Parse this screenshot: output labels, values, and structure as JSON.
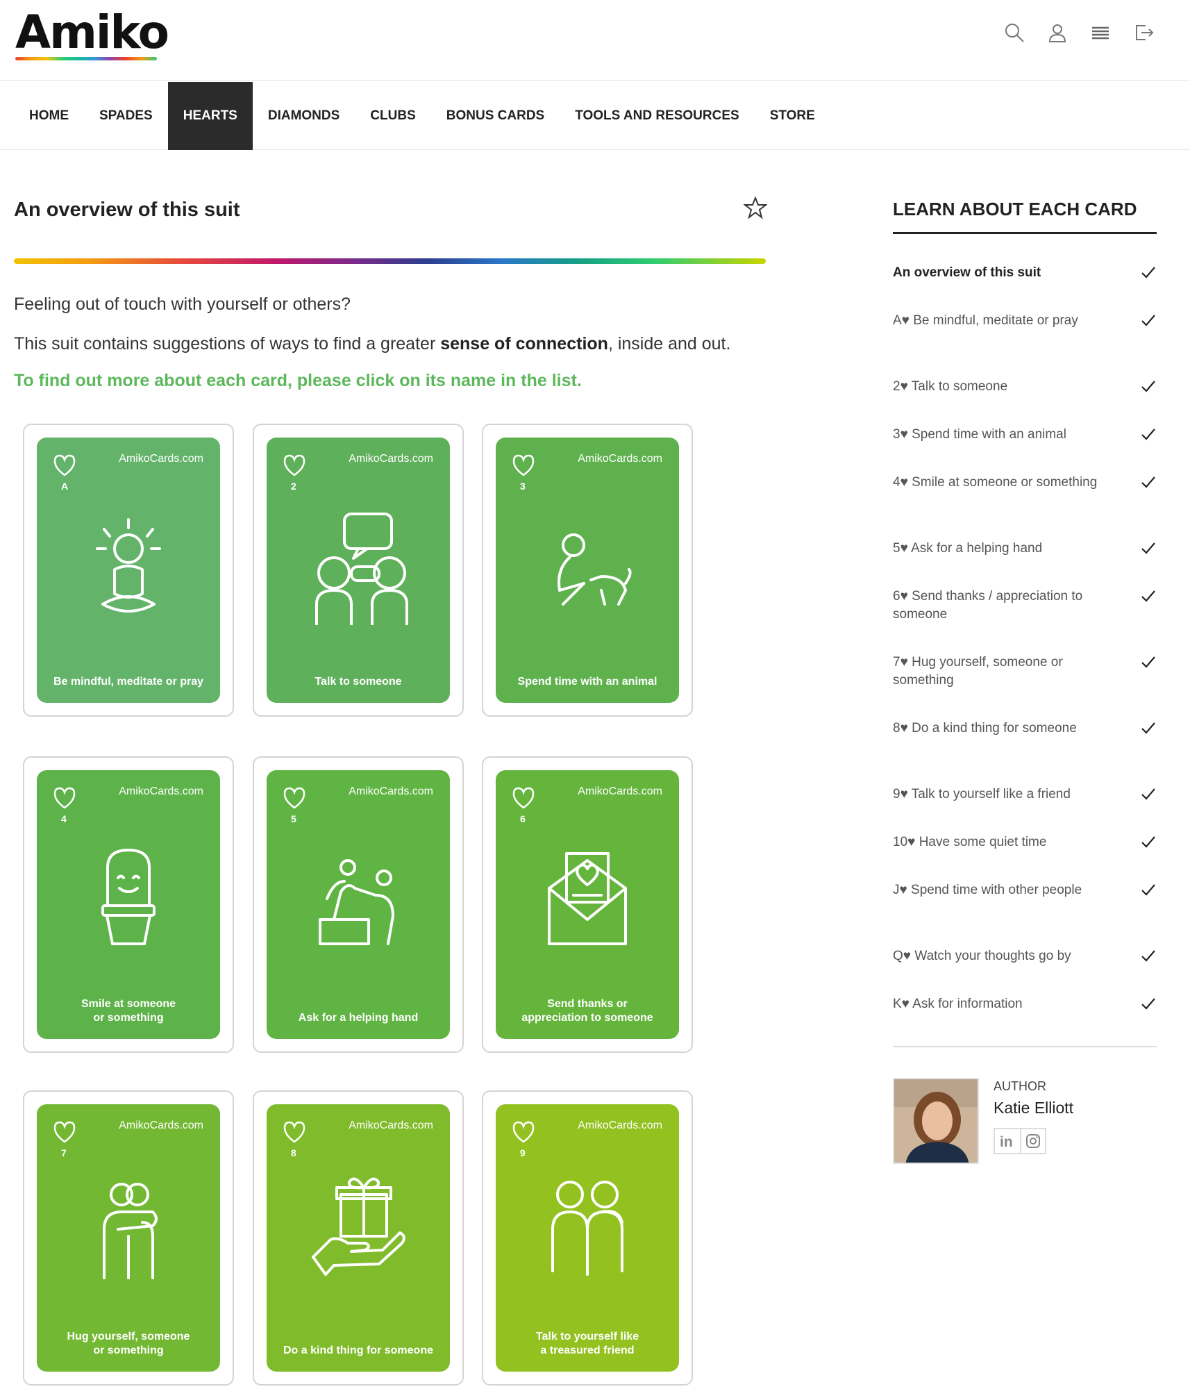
{
  "header": {
    "logo_text": "Amiko",
    "icons": [
      "search-icon",
      "user-icon",
      "menu-icon",
      "logout-icon"
    ]
  },
  "nav": [
    {
      "label": "HOME",
      "active": false
    },
    {
      "label": "SPADES",
      "active": false
    },
    {
      "label": "HEARTS",
      "active": true
    },
    {
      "label": "DIAMONDS",
      "active": false
    },
    {
      "label": "CLUBS",
      "active": false
    },
    {
      "label": "BONUS CARDS",
      "active": false
    },
    {
      "label": "TOOLS AND RESOURCES",
      "active": false
    },
    {
      "label": "STORE",
      "active": false
    }
  ],
  "main": {
    "title": "An overview of this suit",
    "intro1": "Feeling out of touch with yourself or others?",
    "intro2_pre": "This suit contains suggestions of ways to find a greater ",
    "intro2_bold": "sense of connection",
    "intro2_post": ", inside and out.",
    "cta": "To find out more about each card, please click on its name in the list."
  },
  "cards": [
    {
      "rank": "A",
      "site": "AmikoCards.com",
      "caption": "Be mindful, meditate or pray",
      "icon": "meditation-icon",
      "color": "#63b46a"
    },
    {
      "rank": "2",
      "site": "AmikoCards.com",
      "caption": "Talk to someone",
      "icon": "conversation-icon",
      "color": "#5fb05a"
    },
    {
      "rank": "3",
      "site": "AmikoCards.com",
      "caption": "Spend time with an animal",
      "icon": "dog-icon",
      "color": "#5fb14e"
    },
    {
      "rank": "4",
      "site": "AmikoCards.com",
      "caption": "Smile at someone\nor something",
      "icon": "cactus-icon",
      "color": "#5db34a"
    },
    {
      "rank": "5",
      "site": "AmikoCards.com",
      "caption": "Ask for a helping hand",
      "icon": "helping-hand-icon",
      "color": "#60b443"
    },
    {
      "rank": "6",
      "site": "AmikoCards.com",
      "caption": "Send thanks or\nappreciation to someone",
      "icon": "envelope-heart-icon",
      "color": "#65b53d"
    },
    {
      "rank": "7",
      "site": "AmikoCards.com",
      "caption": "Hug yourself, someone\nor something",
      "icon": "hug-icon",
      "color": "#72b832"
    },
    {
      "rank": "8",
      "site": "AmikoCards.com",
      "caption": "Do a kind thing for someone",
      "icon": "gift-icon",
      "color": "#7fbb2a"
    },
    {
      "rank": "9",
      "site": "AmikoCards.com",
      "caption": "Talk to yourself like\na treasured friend",
      "icon": "friends-icon",
      "color": "#93c11f"
    }
  ],
  "sidebar": {
    "heading": "LEARN ABOUT EACH CARD",
    "items": [
      {
        "label": "An overview of this suit"
      },
      {
        "label": "A♥ Be mindful, meditate or pray"
      },
      {
        "label": "2♥ Talk to someone"
      },
      {
        "label": "3♥ Spend time with an animal"
      },
      {
        "label": "4♥ Smile at someone or something"
      },
      {
        "label": "5♥ Ask for a helping hand"
      },
      {
        "label": "6♥ Send thanks / appreciation to someone"
      },
      {
        "label": "7♥ Hug yourself, someone or something"
      },
      {
        "label": "8♥ Do a kind thing for someone"
      },
      {
        "label": "9♥ Talk to yourself like a friend"
      },
      {
        "label": "10♥ Have some quiet time"
      },
      {
        "label": "J♥ Spend time with other people"
      },
      {
        "label": "Q♥ Watch your thoughts go by"
      },
      {
        "label": "K♥ Ask for information"
      }
    ],
    "author_label": "AUTHOR",
    "author_name": "Katie Elliott",
    "social": [
      "linkedin-icon",
      "instagram-icon"
    ]
  }
}
